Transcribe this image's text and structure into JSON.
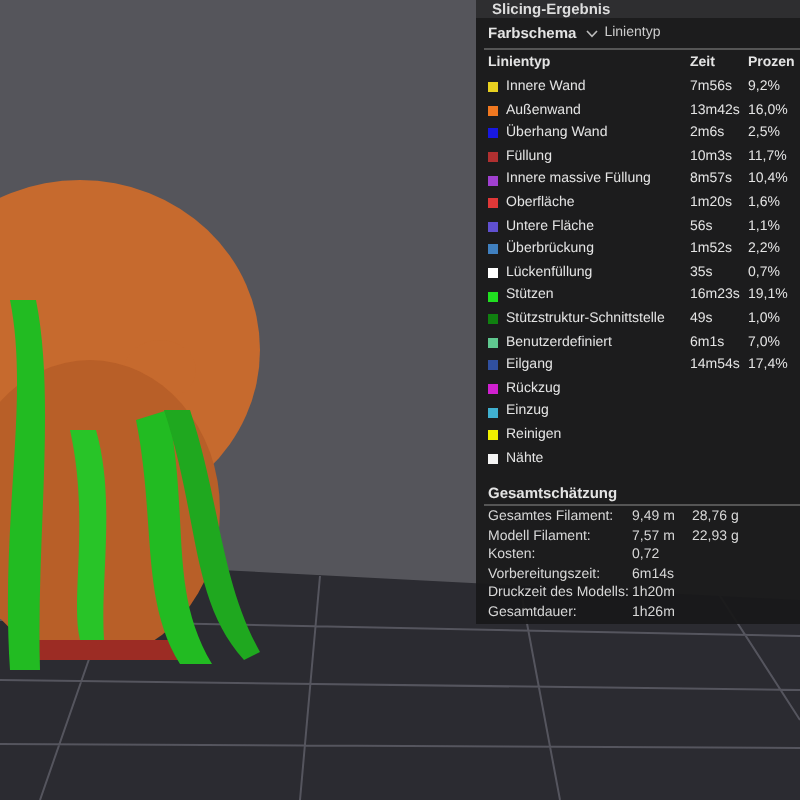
{
  "panel": {
    "title": "Slicing-Ergebnis",
    "color_scheme": {
      "label": "Farbschema",
      "value": "Linientyp"
    },
    "columns": [
      "Linientyp",
      "Zeit",
      "Prozen"
    ],
    "rows": [
      {
        "name": "Innere Wand",
        "color": "#e8d020",
        "time": "7m56s",
        "percent": "9,2%"
      },
      {
        "name": "Außenwand",
        "color": "#f07820",
        "time": "13m42s",
        "percent": "16,0%"
      },
      {
        "name": "Überhang Wand",
        "color": "#1818e0",
        "time": "2m6s",
        "percent": "2,5%"
      },
      {
        "name": "Füllung",
        "color": "#b03030",
        "time": "10m3s",
        "percent": "11,7%"
      },
      {
        "name": "Innere massive Füllung",
        "color": "#a040d0",
        "time": "8m57s",
        "percent": "10,4%"
      },
      {
        "name": "Oberfläche",
        "color": "#e03838",
        "time": "1m20s",
        "percent": "1,6%"
      },
      {
        "name": "Untere Fläche",
        "color": "#6050d0",
        "time": "56s",
        "percent": "1,1%"
      },
      {
        "name": "Überbrückung",
        "color": "#4080c0",
        "time": "1m52s",
        "percent": "2,2%"
      },
      {
        "name": "Lückenfüllung",
        "color": "#ffffff",
        "time": "35s",
        "percent": "0,7%"
      },
      {
        "name": "Stützen",
        "color": "#20e020",
        "time": "16m23s",
        "percent": "19,1%"
      },
      {
        "name": "Stützstruktur-Schnittstelle",
        "color": "#108010",
        "time": "49s",
        "percent": "1,0%"
      },
      {
        "name": "Benutzerdefiniert",
        "color": "#60c890",
        "time": "6m1s",
        "percent": "7,0%"
      },
      {
        "name": "Eilgang",
        "color": "#3050a0",
        "time": "14m54s",
        "percent": "17,4%"
      },
      {
        "name": "Rückzug",
        "color": "#d020d0"
      },
      {
        "name": "Einzug",
        "color": "#40b0d0"
      },
      {
        "name": "Reinigen",
        "color": "#f0f000"
      },
      {
        "name": "Nähte",
        "color": "#f4f4f4"
      }
    ],
    "estimate": {
      "title": "Gesamtschätzung",
      "rows": [
        {
          "label": "Gesamtes Filament:",
          "values": [
            "9,49 m",
            "28,76 g"
          ]
        },
        {
          "label": "Modell Filament:",
          "values": [
            "7,57 m",
            "22,93 g"
          ]
        },
        {
          "label": "Kosten:",
          "values": [
            "0,72"
          ]
        },
        {
          "label": "Vorbereitungszeit:",
          "values": [
            "6m14s"
          ]
        },
        {
          "label": "Druckzeit des Modells:",
          "values": [
            "1h20m"
          ]
        },
        {
          "label": "Gesamtdauer:",
          "values": [
            "1h26m"
          ]
        }
      ]
    }
  }
}
